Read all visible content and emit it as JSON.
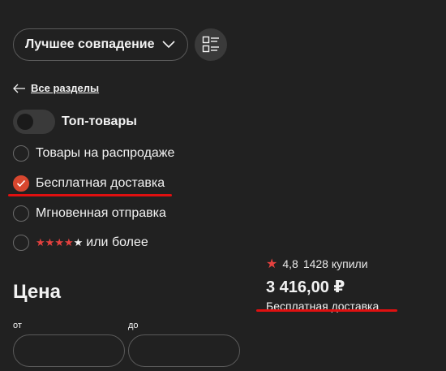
{
  "sort": {
    "label": "Лучшее совпадение",
    "icon": "chevron-down-icon"
  },
  "view_toggle": {
    "icon": "list-view-icon"
  },
  "back_link": {
    "label": "Все разделы",
    "icon": "arrow-left-icon"
  },
  "top_products": {
    "label": "Топ-товары",
    "on": false
  },
  "filters": [
    {
      "label": "Товары на распродаже",
      "checked": false
    },
    {
      "label": "Бесплатная доставка",
      "checked": true
    },
    {
      "label": "Мгновенная отправка",
      "checked": false
    }
  ],
  "rating_filter": {
    "stars_filled": 4,
    "stars_total": 5,
    "suffix": "или более",
    "checked": false
  },
  "price": {
    "title": "Цена",
    "from_label": "от",
    "to_label": "до",
    "from_value": "",
    "to_value": ""
  },
  "product": {
    "rating": "4,8",
    "bought": "1428 купили",
    "price": "3 416,00 ₽",
    "delivery": "Бесплатная доставка"
  },
  "colors": {
    "accent": "#d8472f",
    "underline": "#e01010",
    "background": "#212121"
  }
}
